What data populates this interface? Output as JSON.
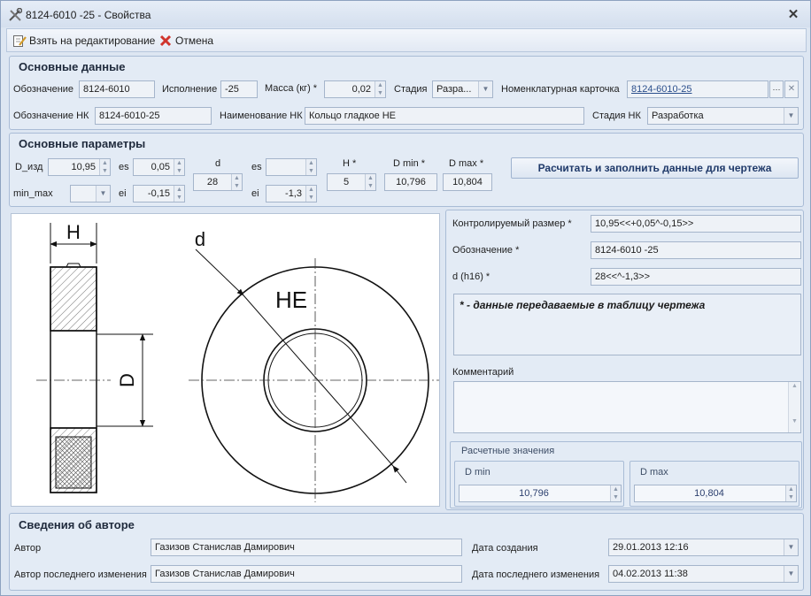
{
  "window": {
    "title": "8124-6010  -25 - Свойства",
    "close_glyph": "✕"
  },
  "toolbar": {
    "edit_label": "Взять на редактирование",
    "cancel_label": "Отмена"
  },
  "main_data": {
    "title": "Основные данные",
    "designation_label": "Обозначение",
    "designation_value": "8124-6010",
    "execution_label": "Исполнение",
    "execution_value": "-25",
    "mass_label": "Масса (кг) *",
    "mass_value": "0,02",
    "stage_label": "Стадия",
    "stage_value": "Разра...",
    "nomenclature_label": "Номенклатурная карточка",
    "nomenclature_value": "8124-6010-25",
    "nomenclature_more": "···",
    "nomenclature_clear": "✕",
    "nk_designation_label": "Обозначение  НК",
    "nk_designation_value": "8124-6010-25",
    "nk_name_label": "Наименование НК",
    "nk_name_value": "Кольцо гладкое НЕ",
    "nk_stage_label": "Стадия НК",
    "nk_stage_value": "Разработка"
  },
  "params": {
    "title": "Основные параметры",
    "d_izd_label": "D_изд",
    "d_izd_value": "10,95",
    "es1_label": "es",
    "es1_value": "0,05",
    "d_label": "d",
    "d_value": "28",
    "es2_label": "es",
    "es2_value": "",
    "h_label": "H *",
    "h_value": "5",
    "dmin_label": "D min *",
    "dmin_value": "10,796",
    "dmax_label": "D max *",
    "dmax_value": "10,804",
    "minmax_label": "min_max",
    "minmax_value": "",
    "ei1_label": "ei",
    "ei1_value": "-0,15",
    "ei2_label": "ei",
    "ei2_value": "-1,3",
    "calc_button": "Расчитать и заполнить данные для чертежа"
  },
  "drawing": {
    "h_label": "H",
    "d_small_label": "d",
    "he_label": "НЕ",
    "d_big_label": "D"
  },
  "right_panel": {
    "controlled_label": "Контролируемый размер *",
    "controlled_value": "10,95<<+0,05^-0,15>>",
    "designation_label": "Обозначение *",
    "designation_value": "8124-6010  -25",
    "d_h16_label": "d (h16) *",
    "d_h16_value": "28<<^-1,3>>",
    "note_text": "* - данные передаваемые в таблицу чертежа",
    "comment_label": "Комментарий",
    "comment_value": "",
    "calc_title": "Расчетные значения",
    "dmin_head": "D min",
    "dmin_value": "10,796",
    "dmax_head": "D max",
    "dmax_value": "10,804"
  },
  "author": {
    "title": "Сведения об авторе",
    "author_label": "Автор",
    "author_value": "Газизов Станислав Дамирович",
    "last_author_label": "Автор последнего изменения",
    "last_author_value": "Газизов Станислав Дамирович",
    "created_label": "Дата создания",
    "created_value": "29.01.2013 12:16",
    "modified_label": "Дата последнего изменения",
    "modified_value": "04.02.2013 11:38"
  },
  "colors": {
    "accent": "#203a6a",
    "link": "#2b4f8c",
    "panel": "#e3ebf5",
    "window": "#dde6f2"
  }
}
